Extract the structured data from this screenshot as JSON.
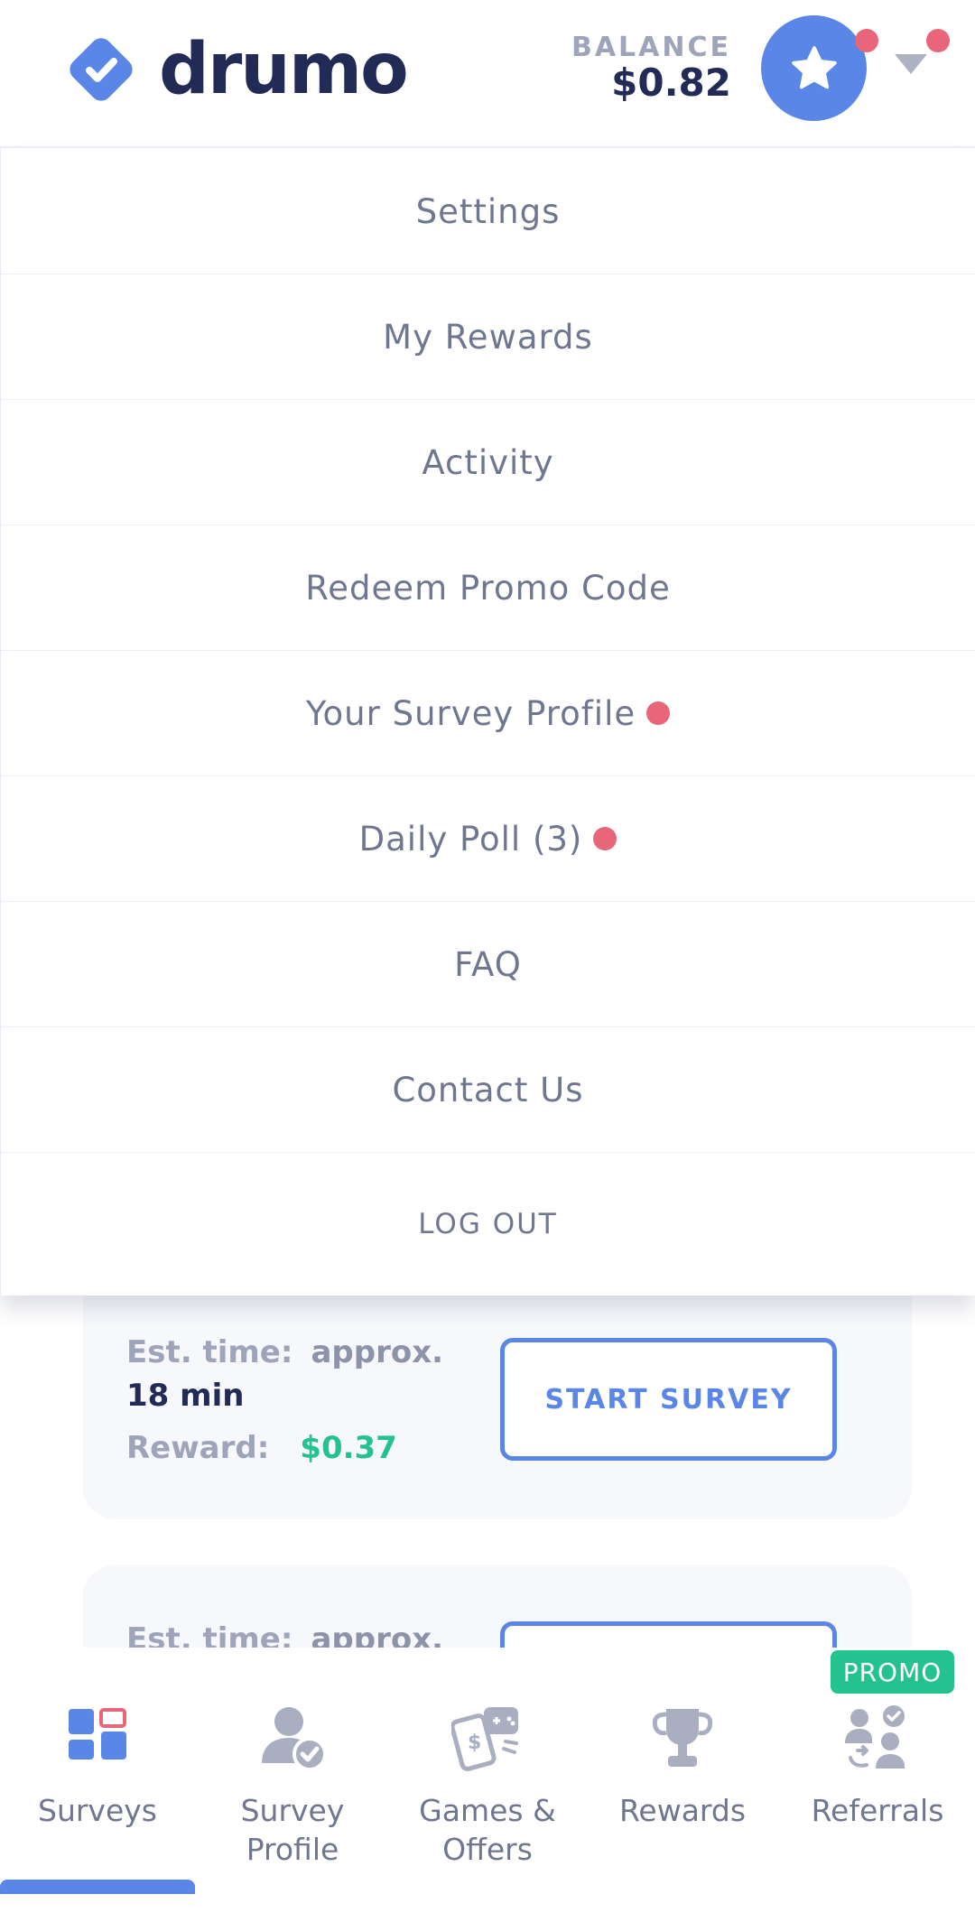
{
  "header": {
    "logo_text": "drumo",
    "balance_label": "BALANCE",
    "balance_value": "$0.82"
  },
  "menu": {
    "items": [
      {
        "label": "Settings",
        "dot": false
      },
      {
        "label": "My Rewards",
        "dot": false
      },
      {
        "label": "Activity",
        "dot": false
      },
      {
        "label": "Redeem Promo Code",
        "dot": false
      },
      {
        "label": "Your Survey Profile",
        "dot": true
      },
      {
        "label": "Daily Poll (3)",
        "dot": true
      },
      {
        "label": "FAQ",
        "dot": false
      },
      {
        "label": "Contact Us",
        "dot": false
      },
      {
        "label": "LOG OUT",
        "dot": false
      }
    ]
  },
  "cards": [
    {
      "est_label": "Est. time:",
      "est_value_1": "approx.",
      "est_value_2": "18 min",
      "reward_label": "Reward:",
      "reward_value": "$0.37",
      "button_label": "START SURVEY"
    },
    {
      "est_label": "Est. time:",
      "est_value_1": "approx."
    }
  ],
  "bottom_nav": {
    "items": [
      {
        "label": "Surveys",
        "icon": "grid-icon",
        "active": true
      },
      {
        "label": "Survey Profile",
        "icon": "profile-check-icon",
        "active": false
      },
      {
        "label": "Games & Offers",
        "icon": "games-icon",
        "active": false
      },
      {
        "label": "Rewards",
        "icon": "trophy-icon",
        "active": false
      },
      {
        "label": "Referrals",
        "icon": "referrals-icon",
        "active": false
      }
    ],
    "promo_badge": "PROMO"
  },
  "colors": {
    "accent": "#5a86e8",
    "brand_dark": "#222a56",
    "notification": "#e8657a",
    "reward_green": "#23c28f",
    "muted_text": "#6f7690"
  }
}
